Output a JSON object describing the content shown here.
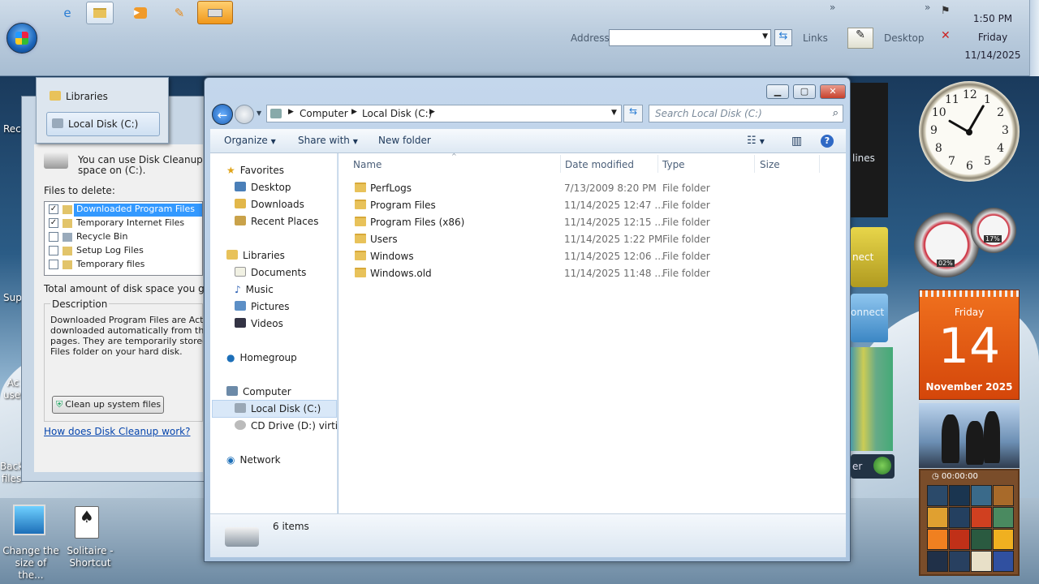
{
  "taskbar": {
    "address_label": "Address",
    "links_label": "Links",
    "desktop_label": "Desktop",
    "overflow_glyph": "»",
    "clock": {
      "time": "1:50 PM",
      "day": "Friday",
      "date": "11/14/2025"
    }
  },
  "libraries_popup": {
    "items": [
      "Libraries",
      "Local Disk (C:)"
    ]
  },
  "disk_cleanup": {
    "intro": "You can use Disk Cleanup to fre",
    "intro2": "space on  (C:).",
    "files_to_delete_label": "Files to delete:",
    "files": [
      {
        "label": "Downloaded Program Files",
        "checked": true
      },
      {
        "label": "Temporary Internet Files",
        "checked": true
      },
      {
        "label": "Recycle Bin",
        "checked": false
      },
      {
        "label": "Setup Log Files",
        "checked": false
      },
      {
        "label": "Temporary files",
        "checked": false
      }
    ],
    "total_label": "Total amount of disk space you gain:",
    "description_label": "Description",
    "description": [
      "Downloaded Program Files are ActiveX",
      "downloaded automatically from the Inter",
      "pages. They are temporarily stored in the",
      "Files folder on your hard disk."
    ],
    "cleanup_button": "Clean up system files",
    "help_link": "How does Disk Cleanup work?"
  },
  "explorer": {
    "breadcrumb": [
      "Computer",
      "Local Disk (C:)"
    ],
    "search_placeholder": "Search Local Disk (C:)",
    "toolbar": {
      "organize": "Organize",
      "share_with": "Share with",
      "new_folder": "New folder"
    },
    "nav": {
      "favorites": "Favorites",
      "favorites_items": [
        "Desktop",
        "Downloads",
        "Recent Places"
      ],
      "libraries": "Libraries",
      "libraries_items": [
        "Documents",
        "Music",
        "Pictures",
        "Videos"
      ],
      "homegroup": "Homegroup",
      "computer": "Computer",
      "computer_items": [
        "Local Disk (C:)",
        "CD Drive (D:) virtio-v"
      ],
      "network": "Network"
    },
    "columns": [
      "Name",
      "Date modified",
      "Type",
      "Size"
    ],
    "rows": [
      {
        "name": "PerfLogs",
        "date": "7/13/2009 8:20 PM",
        "type": "File folder"
      },
      {
        "name": "Program Files",
        "date": "11/14/2025 12:47 ...",
        "type": "File folder"
      },
      {
        "name": "Program Files (x86)",
        "date": "11/14/2025 12:15 ...",
        "type": "File folder"
      },
      {
        "name": "Users",
        "date": "11/14/2025 1:22 PM",
        "type": "File folder"
      },
      {
        "name": "Windows",
        "date": "11/14/2025 12:06 ...",
        "type": "File folder"
      },
      {
        "name": "Windows.old",
        "date": "11/14/2025 11:48 ...",
        "type": "File folder"
      }
    ],
    "status": "6 items"
  },
  "desktop": {
    "icons": [
      "Change the size of the...",
      "Solitaire - Shortcut"
    ],
    "edge_labels": [
      "Rec",
      "Sup",
      "Ac user",
      "Back files"
    ],
    "gadget_side_labels": [
      "lines",
      "nect",
      "onnect",
      "er"
    ]
  },
  "gadgets": {
    "clock_numbers": [
      "12",
      "1",
      "2",
      "3",
      "4",
      "5",
      "6",
      "7",
      "8",
      "9",
      "10",
      "11"
    ],
    "meter_cpu": "02%",
    "meter_mem": "17%",
    "calendar": {
      "weekday": "Friday",
      "day": "14",
      "month_year": "November 2025"
    },
    "puzzle_timer": "00:00:00"
  }
}
